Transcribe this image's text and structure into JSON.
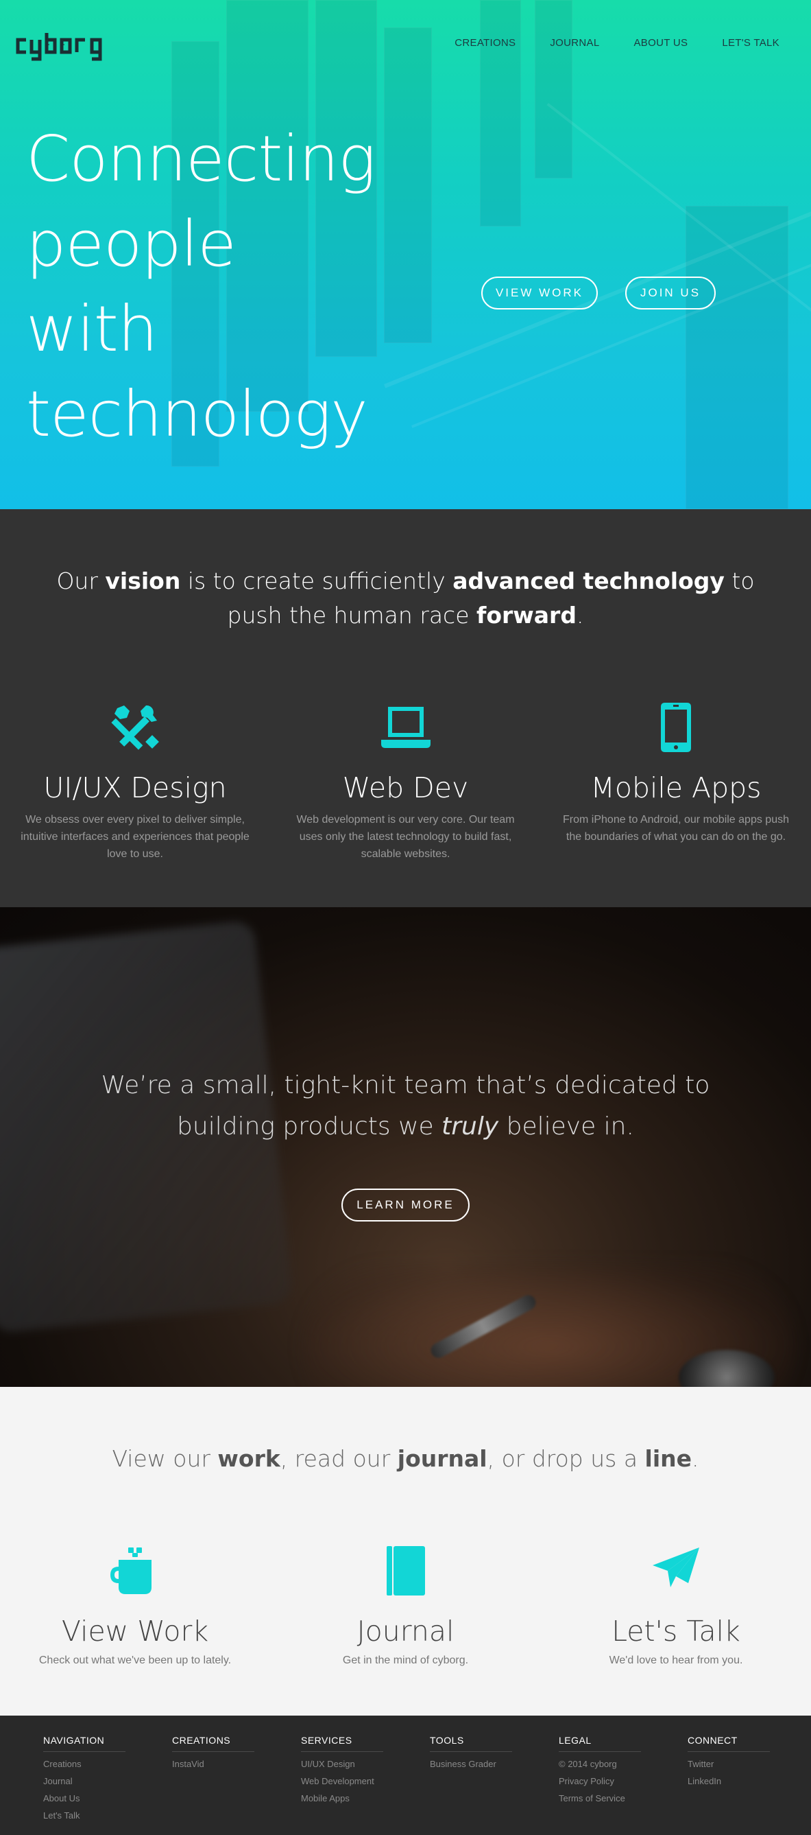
{
  "brand": {
    "logo_text": "cyborg",
    "accent": "#12d6d6"
  },
  "nav": {
    "items": [
      "CREATIONS",
      "JOURNAL",
      "ABOUT US",
      "LET'S TALK"
    ]
  },
  "hero": {
    "title_lines": [
      "Connecting",
      "people",
      "with",
      "technology"
    ],
    "view_work_label": "VIEW WORK",
    "join_us_label": "JOIN US"
  },
  "vision": {
    "quote_parts": [
      "Our ",
      "vision",
      " is to create sufficiently ",
      "advanced technology",
      " to",
      "push the human race ",
      "forward",
      "."
    ],
    "services": [
      {
        "icon": "tools-icon",
        "title": "UI/UX Design",
        "desc": "We obsess over every pixel to deliver simple, intuitive interfaces and experiences that people love to use."
      },
      {
        "icon": "laptop-icon",
        "title": "Web Dev",
        "desc": "Web development is our very core. Our team uses only the latest technology to build fast, scalable websites."
      },
      {
        "icon": "phone-icon",
        "title": "Mobile Apps",
        "desc": "From iPhone to Android, our mobile apps push the boundaries of what you can do on the go."
      }
    ]
  },
  "team": {
    "quote_line1": "We’re a small, tight-knit team that’s dedicated to",
    "quote_line2_a": "building products we ",
    "quote_line2_em": "truly",
    "quote_line2_b": " believe in.",
    "learn_more_label": "LEARN MORE"
  },
  "links": {
    "quote_parts": [
      "View our ",
      "work",
      ", read our ",
      "journal",
      ", or drop us a ",
      "line",
      "."
    ],
    "cards": [
      {
        "icon": "coffee-mug-icon",
        "title": "View Work",
        "desc": "Check out what we've been up to lately."
      },
      {
        "icon": "book-icon",
        "title": "Journal",
        "desc": "Get in the mind of cyborg."
      },
      {
        "icon": "paper-plane-icon",
        "title": "Let's Talk",
        "desc": "We'd love to hear from you."
      }
    ]
  },
  "footer": {
    "columns": [
      {
        "heading": "NAVIGATION",
        "items": [
          "Creations",
          "Journal",
          "About Us",
          "Let's Talk"
        ]
      },
      {
        "heading": "CREATIONS",
        "items": [
          "InstaVid"
        ]
      },
      {
        "heading": "SERVICES",
        "items": [
          "UI/UX Design",
          "Web Development",
          "Mobile Apps"
        ]
      },
      {
        "heading": "TOOLS",
        "items": [
          "Business Grader"
        ]
      },
      {
        "heading": "LEGAL",
        "items": [
          "© 2014 cyborg",
          "Privacy Policy",
          "Terms of Service"
        ]
      },
      {
        "heading": "CONNECT",
        "items": [
          "Twitter",
          "LinkedIn"
        ]
      }
    ]
  }
}
